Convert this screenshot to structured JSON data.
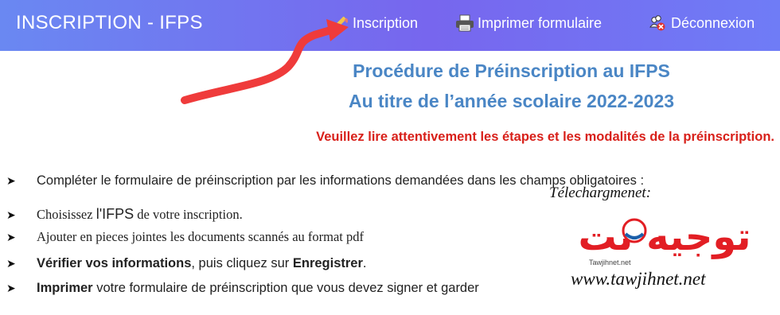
{
  "header": {
    "brand": "INSCRIPTION - IFPS",
    "nav": [
      {
        "label": "Inscription",
        "icon": "pencil-icon"
      },
      {
        "label": "Imprimer formulaire",
        "icon": "printer-icon"
      },
      {
        "label": "Déconnexion",
        "icon": "logout-icon"
      }
    ]
  },
  "content": {
    "title1": "Procédure de Préinscription au IFPS",
    "title2": "Au titre de l’année scolaire 2022-2023",
    "notice": "Veuillez lire attentivement les étapes et les modalités de la préinscription.",
    "steps": [
      {
        "text": "Compléter le formulaire de préinscription par les informations demandées dans les champs obligatoires :"
      },
      {
        "a": "Choisissez ",
        "b": "l'IFPS",
        "c": " de votre inscription."
      },
      {
        "text": "Ajouter en pieces jointes les documents scannés au format pdf"
      },
      {
        "a": "Vérifier vos informations",
        "b": ", puis cliquez sur ",
        "c": "Enregistrer",
        "d": "."
      },
      {
        "a": "Imprimer",
        "b": " votre formulaire de préinscription que vous devez signer et garder"
      }
    ],
    "bullet": "➤"
  },
  "watermark": {
    "top": "Télechargmenet:",
    "arabic": "توجيه نت",
    "small": "Tawjihnet.net",
    "url": "www.tawjihnet.net"
  },
  "colors": {
    "header": "#7070ee",
    "title": "#4a86c5",
    "notice": "#d8201a",
    "annotation": "#ef3b3b"
  }
}
